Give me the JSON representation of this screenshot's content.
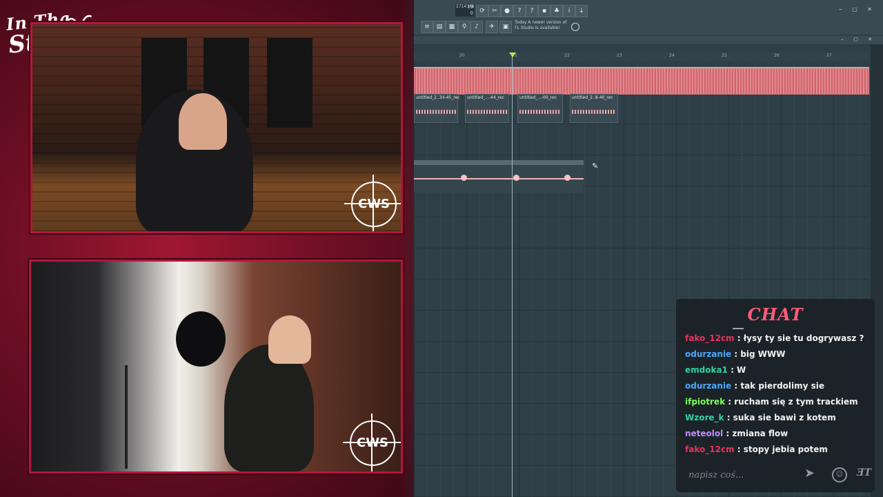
{
  "overlay": {
    "logo_line1": "In Tha",
    "logo_line2": "Studio!",
    "watermark": "CWS"
  },
  "fl_studio": {
    "monitor_top": "19",
    "ram": "2714 MB",
    "monitor_bottom": "0",
    "notice_line1": "Today  A newer version of",
    "notice_line2": "FL Studio is available!",
    "ruler_ticks": [
      "20",
      "21",
      "22",
      "23",
      "24",
      "25",
      "26",
      "27"
    ],
    "clips": [
      {
        "name": "untitled_2..34-45_rec"
      },
      {
        "name": "untitled_...-44_rec"
      },
      {
        "name": "untitled_...-00_rec"
      },
      {
        "name": "untitled_2..8-40_rec"
      }
    ],
    "automation_points": 3
  },
  "chat": {
    "title": "CHAT",
    "messages": [
      {
        "user": "fako_12cm",
        "color": "#e8335f",
        "text": " : łysy ty sie tu dogrywasz ?"
      },
      {
        "user": "odurzanie",
        "color": "#4aa8ff",
        "text": " : big WWW"
      },
      {
        "user": "emdoka1",
        "color": "#2fd3a2",
        "text": " : W"
      },
      {
        "user": "odurzanie",
        "color": "#4aa8ff",
        "text": " : tak pierdolimy sie"
      },
      {
        "user": "ifpiotrek",
        "color": "#7dff57",
        "text": " : rucham się z tym trackiem"
      },
      {
        "user": "Wzore_k",
        "color": "#2fd3a2",
        "text": " : suka sie bawi z kotem"
      },
      {
        "user": "neteolol",
        "color": "#c08cff",
        "text": " : zmiana flow"
      },
      {
        "user": "fako_12cm",
        "color": "#e8335f",
        "text": " : stopy jebia potem"
      }
    ],
    "input_placeholder": "napisz coś..."
  }
}
